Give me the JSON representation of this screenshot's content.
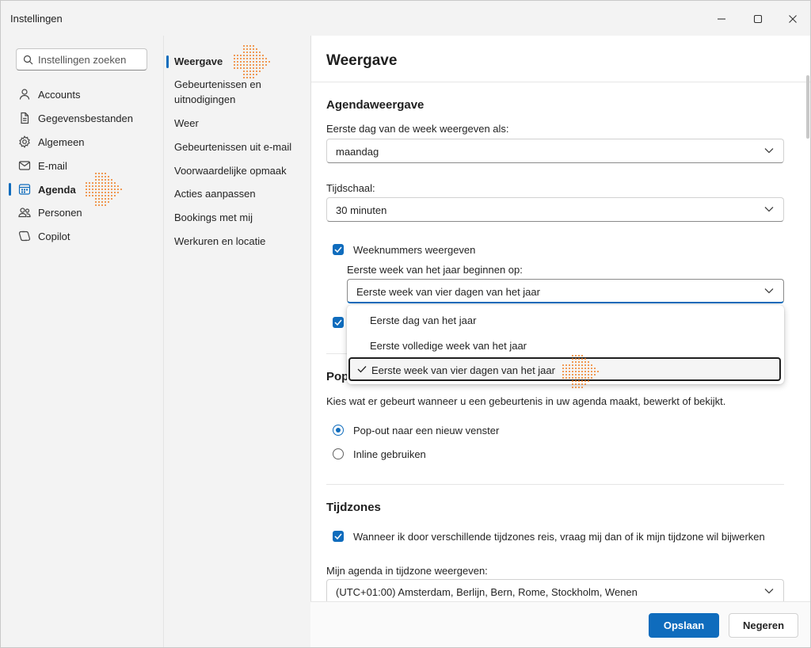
{
  "window": {
    "title": "Instellingen"
  },
  "nav": {
    "search_placeholder": "Instellingen zoeken",
    "items": [
      {
        "label": "Accounts",
        "icon": "person-icon"
      },
      {
        "label": "Gegevensbestanden",
        "icon": "document-icon"
      },
      {
        "label": "Algemeen",
        "icon": "gear-icon"
      },
      {
        "label": "E-mail",
        "icon": "mail-icon"
      },
      {
        "label": "Agenda",
        "icon": "calendar-icon",
        "active": true
      },
      {
        "label": "Personen",
        "icon": "people-icon"
      },
      {
        "label": "Copilot",
        "icon": "copilot-icon"
      }
    ]
  },
  "subnav": {
    "items": [
      {
        "label": "Weergave",
        "active": true
      },
      {
        "label": "Gebeurtenissen en uitnodigingen"
      },
      {
        "label": "Weer"
      },
      {
        "label": "Gebeurtenissen uit e-mail"
      },
      {
        "label": "Voorwaardelijke opmaak"
      },
      {
        "label": "Acties aanpassen"
      },
      {
        "label": "Bookings met mij"
      },
      {
        "label": "Werkuren en locatie"
      }
    ]
  },
  "content": {
    "page_title": "Weergave",
    "section_agenda": "Agendaweergave",
    "first_day_label": "Eerste dag van de week weergeven als:",
    "first_day_value": "maandag",
    "timescale_label": "Tijdschaal:",
    "timescale_value": "30 minuten",
    "week_numbers_label": "Weeknummers weergeven",
    "week_start_label": "Eerste week van het jaar beginnen op:",
    "week_start_value": "Eerste week van vier dagen van het jaar",
    "week_start_options": [
      "Eerste dag van het jaar",
      "Eerste volledige week van het jaar",
      "Eerste week van vier dagen van het jaar"
    ],
    "popout_heading_partial": "Pop",
    "popout_desc": "Kies wat er gebeurt wanneer u een gebeurtenis in uw agenda maakt, bewerkt of bekijkt.",
    "radio_popout": "Pop-out naar een nieuw venster",
    "radio_inline": "Inline gebruiken",
    "section_timezones": "Tijdzones",
    "timezone_check_label": "Wanneer ik door verschillende tijdzones reis, vraag mij dan of ik mijn tijdzone wil bijwerken",
    "timezone_select_label": "Mijn agenda in tijdzone weergeven:",
    "timezone_value": "(UTC+01:00) Amsterdam, Berlijn, Bern, Rome, Stockholm, Wenen"
  },
  "footer": {
    "save": "Opslaan",
    "cancel": "Negeren"
  },
  "colors": {
    "accent": "#0f6cbd",
    "annotation": "#f07c22"
  }
}
